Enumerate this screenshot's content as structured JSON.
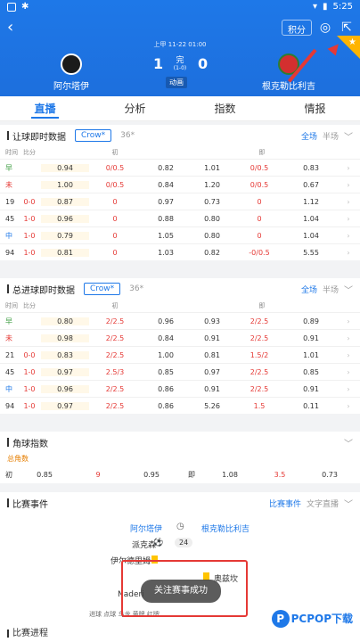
{
  "status": {
    "time": "5:25"
  },
  "header": {
    "points_btn": "积分",
    "match_time": "上甲 11-22 01:00",
    "home": "阿尔塔伊",
    "away": "根克勒比利吉",
    "home_score": "1",
    "away_score": "0",
    "mid_label": "完",
    "half_score": "(1-0)",
    "anim_label": "动画"
  },
  "tabs": [
    "直播",
    "分析",
    "指数",
    "情报"
  ],
  "handicap": {
    "title": "让球即时数据",
    "pill": "Crow*",
    "pill2": "36*",
    "seg_on": "全场",
    "seg_off": "半场",
    "cols": [
      "时间",
      "比分",
      "初",
      "",
      "即"
    ],
    "rows": [
      [
        "早",
        "",
        "0.94",
        "0/0.5",
        "0.82",
        "1.01",
        "0/0.5",
        "0.83"
      ],
      [
        "未",
        "",
        "1.00",
        "0/0.5",
        "0.84",
        "1.20",
        "0/0.5",
        "0.67"
      ],
      [
        "19",
        "0-0",
        "0.87",
        "0",
        "0.97",
        "0.73",
        "0",
        "1.12"
      ],
      [
        "45",
        "1-0",
        "0.96",
        "0",
        "0.88",
        "0.80",
        "0",
        "1.04"
      ],
      [
        "中",
        "1-0",
        "0.79",
        "0",
        "1.05",
        "0.80",
        "0",
        "1.04"
      ],
      [
        "94",
        "1-0",
        "0.81",
        "0",
        "1.03",
        "0.82",
        "-0/0.5",
        "5.55"
      ]
    ]
  },
  "totals": {
    "title": "总进球即时数据",
    "pill": "Crow*",
    "pill2": "36*",
    "seg_on": "全场",
    "seg_off": "半场",
    "cols": [
      "时间",
      "比分",
      "初",
      "",
      "即"
    ],
    "rows": [
      [
        "早",
        "",
        "0.80",
        "2/2.5",
        "0.96",
        "0.93",
        "2/2.5",
        "0.89"
      ],
      [
        "未",
        "",
        "0.98",
        "2/2.5",
        "0.84",
        "0.91",
        "2/2.5",
        "0.91"
      ],
      [
        "21",
        "0-0",
        "0.83",
        "2/2.5",
        "1.00",
        "0.81",
        "1.5/2",
        "1.01"
      ],
      [
        "45",
        "1-0",
        "0.97",
        "2.5/3",
        "0.85",
        "0.97",
        "2/2.5",
        "0.85"
      ],
      [
        "中",
        "1-0",
        "0.96",
        "2/2.5",
        "0.86",
        "0.91",
        "2/2.5",
        "0.91"
      ],
      [
        "94",
        "1-0",
        "0.97",
        "2/2.5",
        "0.86",
        "5.26",
        "1.5",
        "0.11"
      ]
    ]
  },
  "corner": {
    "title": "角球指数",
    "total_label": "总角数",
    "row": [
      "初",
      "0.85",
      "9",
      "0.95",
      "即",
      "1.08",
      "3.5",
      "0.73"
    ]
  },
  "events": {
    "title": "比赛事件",
    "tab_on": "比赛事件",
    "tab_off": "文字直播",
    "home": "阿尔塔伊",
    "away": "根克勒比利吉",
    "player1": "派克森",
    "minute1": "24",
    "player2": "伊尔德里姆",
    "player3": "Naderi",
    "player4": "奥兹坎",
    "legend": "进球   点球   乌龙   黄牌   红牌"
  },
  "toast": "关注赛事成功",
  "footer": {
    "title": "比赛进程"
  },
  "watermark": "PCPOP下载"
}
